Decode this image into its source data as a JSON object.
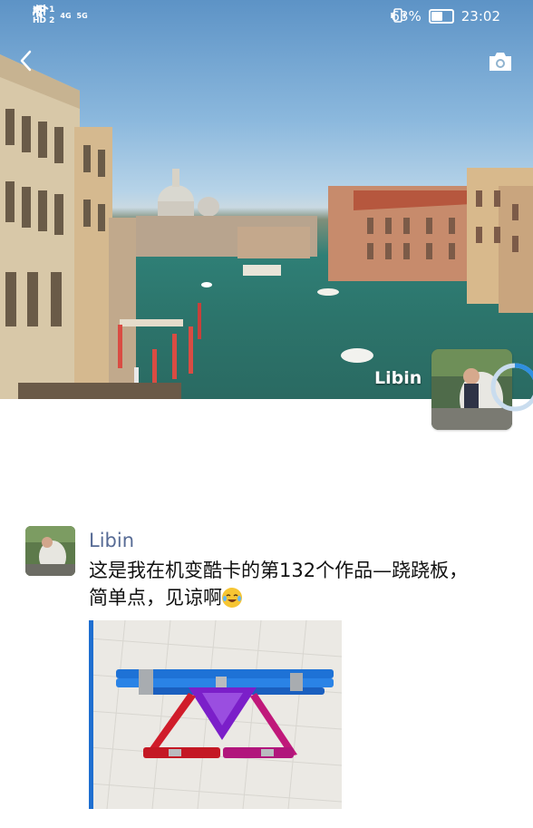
{
  "status_bar": {
    "left_sim1": "HD 1",
    "left_sim2": "HD 2",
    "network1": "4G",
    "network2": "5G",
    "battery_percent": "63%",
    "battery_level": 0.63,
    "time": "23:02"
  },
  "header": {
    "back_icon": "chevron-left-icon",
    "camera_icon": "camera-icon"
  },
  "cover": {
    "name": "Libin"
  },
  "post": {
    "author": "Libin",
    "text_line1": "这是我在机变酷卡的第132个作品—跷跷板，",
    "text_line2": "简单点，见谅啊",
    "emoji": "laughing-tears-emoji"
  }
}
